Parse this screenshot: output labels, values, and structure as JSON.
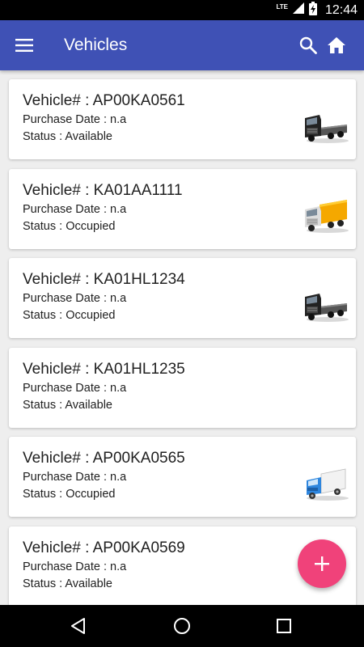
{
  "status_bar": {
    "network": "LTE",
    "time": "12:44"
  },
  "app_bar": {
    "title": "Vehicles",
    "menu_icon": "menu-icon",
    "search_icon": "search-icon",
    "home_icon": "home-icon"
  },
  "vehicles": [
    {
      "label": "Vehicle# : AP00KA0561",
      "purchase": "Purchase Date : n.a",
      "status": "Status : Available",
      "icon": "black-truck-icon"
    },
    {
      "label": "Vehicle# : KA01AA1111",
      "purchase": "Purchase Date : n.a",
      "status": "Status : Occupied",
      "icon": "yellow-truck-icon"
    },
    {
      "label": "Vehicle# : KA01HL1234",
      "purchase": "Purchase Date : n.a",
      "status": "Status : Occupied",
      "icon": "black-truck-icon"
    },
    {
      "label": "Vehicle# : KA01HL1235",
      "purchase": "Purchase Date : n.a",
      "status": "Status : Available",
      "icon": ""
    },
    {
      "label": "Vehicle# : AP00KA0565",
      "purchase": "Purchase Date : n.a",
      "status": "Status : Occupied",
      "icon": "white-truck-icon"
    },
    {
      "label": "Vehicle# : AP00KA0569",
      "purchase": "Purchase Date : n.a",
      "status": "Status : Available",
      "icon": ""
    }
  ],
  "fab": {
    "icon": "add-icon"
  },
  "nav_bar": {
    "back_icon": "back-icon",
    "home_icon": "home-circle-icon",
    "recents_icon": "recents-icon"
  },
  "colors": {
    "primary": "#3F51B5",
    "accent": "#F0427A",
    "background": "#EEEEEE",
    "card": "#FFFFFF"
  }
}
